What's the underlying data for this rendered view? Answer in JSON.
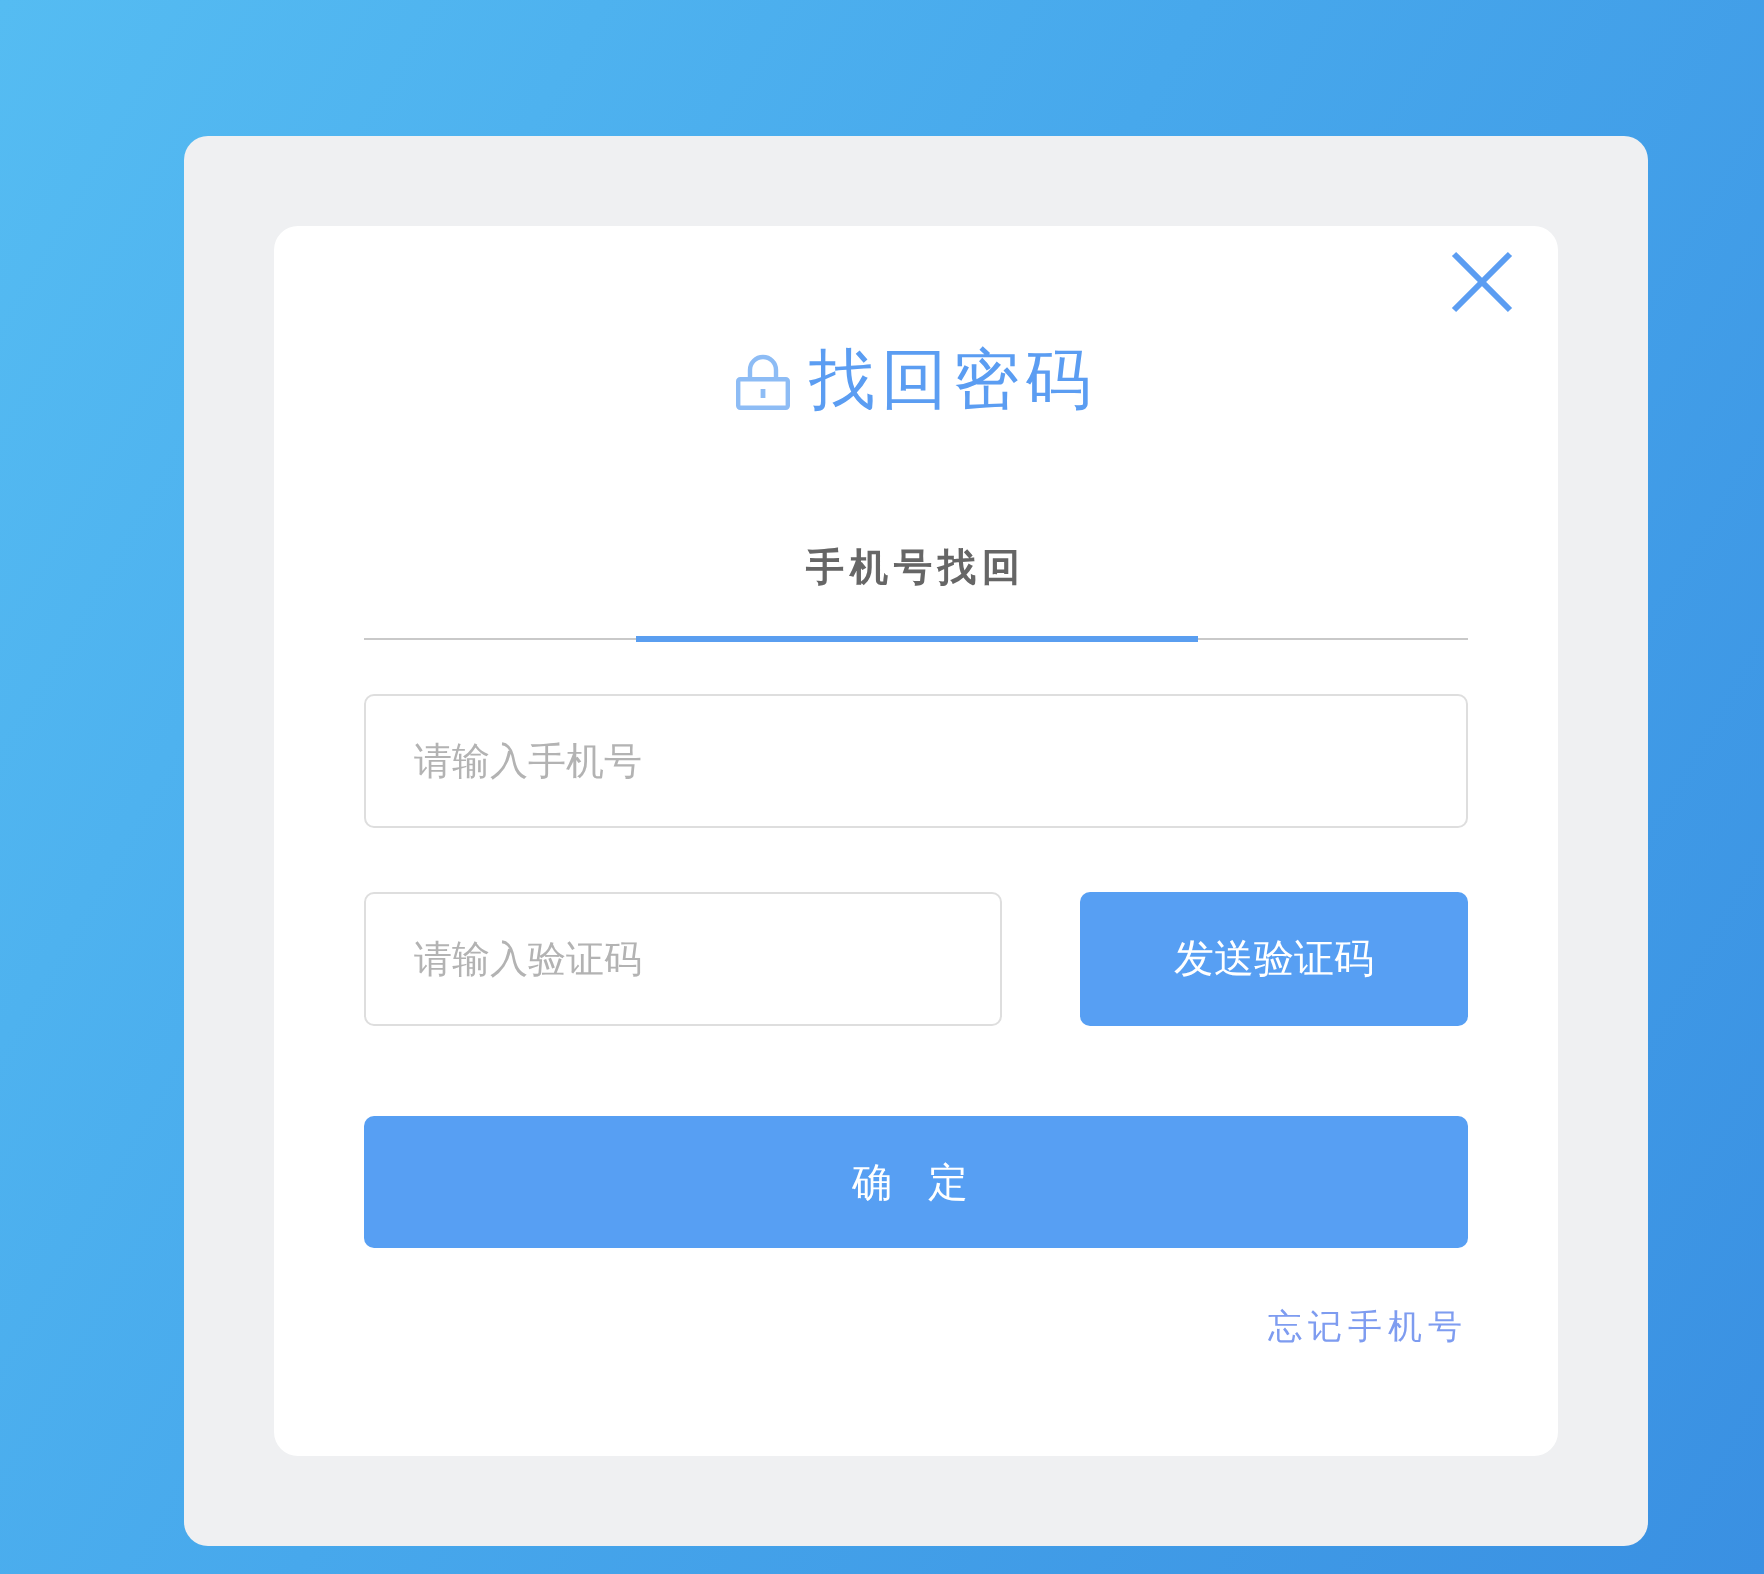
{
  "dialog": {
    "title": "找回密码"
  },
  "tabs": [
    {
      "label": "手机号找回",
      "selected": true
    }
  ],
  "phone_field": {
    "placeholder": "请输入手机号"
  },
  "code_field": {
    "placeholder": "请输入验证码"
  },
  "send_code_button": {
    "label": "发送验证码"
  },
  "confirm_button": {
    "label": "确 定"
  },
  "forgot_link": {
    "label": "忘记手机号"
  }
}
